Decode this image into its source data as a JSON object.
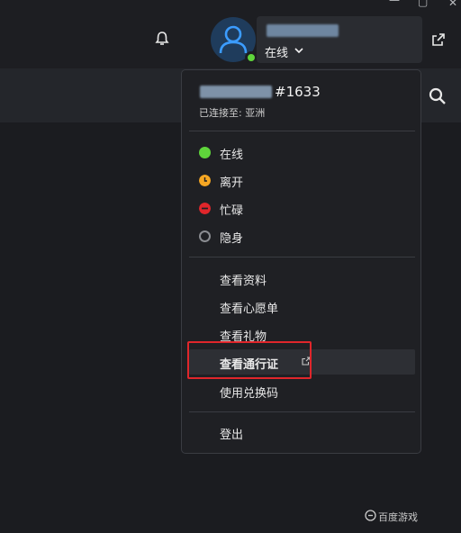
{
  "header": {
    "user_status": "在线",
    "status_color": "#5fd53b"
  },
  "menu": {
    "tag": "#1633",
    "region": "已连接至: 亚洲",
    "statuses": [
      {
        "label": "在线",
        "color": "#5fd53b"
      },
      {
        "label": "离开",
        "color": "#f5a623"
      },
      {
        "label": "忙碌",
        "color": "#e0262b"
      },
      {
        "label": "隐身",
        "color": "#8a8c91"
      }
    ],
    "actions": [
      {
        "label": "查看资料"
      },
      {
        "label": "查看心愿单"
      },
      {
        "label": "查看礼物"
      },
      {
        "label": "查看通行证"
      },
      {
        "label": "使用兑换码"
      }
    ],
    "logout": "登出"
  },
  "icons": [
    "bell-icon",
    "external-link-icon",
    "search-icon",
    "avatar-icon",
    "chevron-down-icon",
    "minimize-icon",
    "maximize-icon",
    "close-icon"
  ],
  "watermark": "百度游戏"
}
